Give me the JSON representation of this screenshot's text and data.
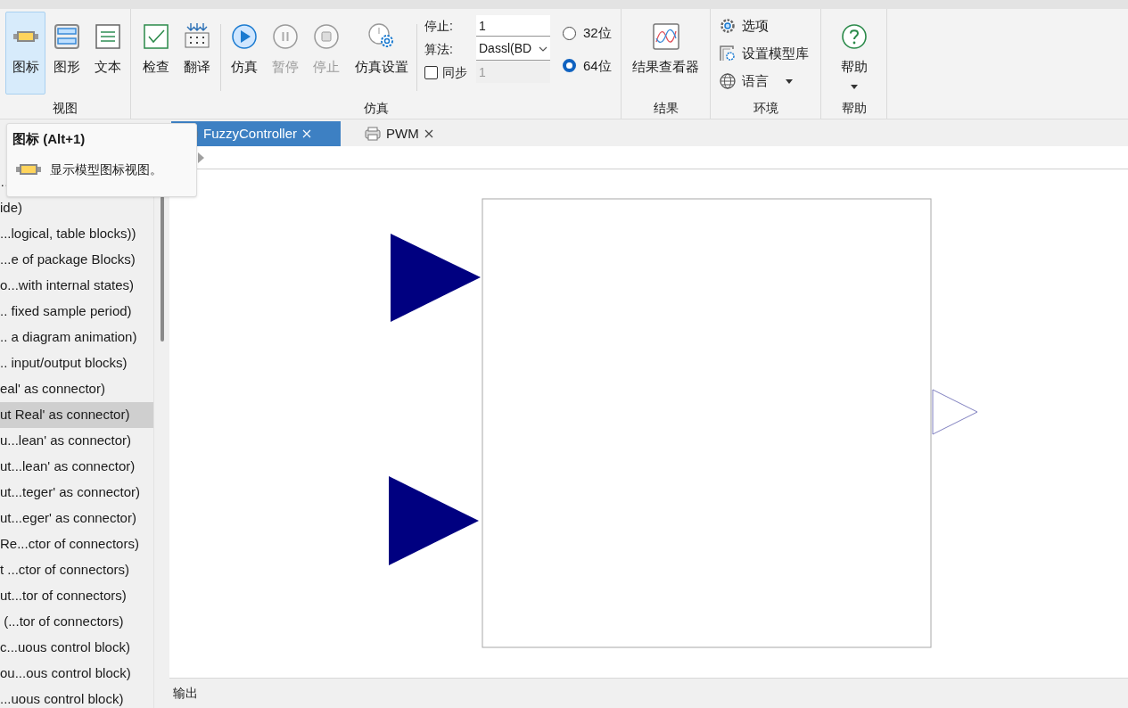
{
  "ribbon": {
    "view": {
      "label": "视图",
      "buttons": [
        {
          "label": "图标",
          "selected": true
        },
        {
          "label": "图形",
          "selected": false
        },
        {
          "label": "文本",
          "selected": false
        }
      ]
    },
    "simulation": {
      "label": "仿真",
      "buttons": [
        {
          "label": "检查",
          "disabled": false
        },
        {
          "label": "翻译",
          "disabled": false
        },
        {
          "label": "仿真",
          "disabled": false
        },
        {
          "label": "暂停",
          "disabled": true
        },
        {
          "label": "停止",
          "disabled": true
        },
        {
          "label": "仿真设置",
          "disabled": false
        }
      ],
      "stop_time": {
        "label": "停止:",
        "value": "1"
      },
      "solver": {
        "label": "算法:",
        "value": "Dassl(BD"
      },
      "sync": {
        "label": "同步",
        "checked": false,
        "value": "1"
      },
      "bits": [
        {
          "label": "32位",
          "selected": false
        },
        {
          "label": "64位",
          "selected": true
        }
      ]
    },
    "results": {
      "label": "结果",
      "buttons": [
        {
          "label": "结果查看器"
        }
      ]
    },
    "environment": {
      "label": "环境",
      "items": [
        {
          "label": "选项",
          "dropdown": false
        },
        {
          "label": "设置模型库",
          "dropdown": false
        },
        {
          "label": "语言",
          "dropdown": true
        }
      ]
    },
    "help": {
      "label": "帮助",
      "buttons": [
        {
          "label": "帮助",
          "dropdown": true
        }
      ]
    }
  },
  "tooltip": {
    "title": "图标 (Alt+1)",
    "text": "显示模型图标视图。"
  },
  "tabs": [
    {
      "label": "FuzzyController",
      "selected": true
    },
    {
      "label": "PWM",
      "selected": false
    }
  ],
  "library_list": [
    {
      "text": "…",
      "selected": false
    },
    {
      "text": "ide)",
      "selected": false
    },
    {
      "text": "...logical, table blocks))",
      "selected": false
    },
    {
      "text": "...e of package Blocks)",
      "selected": false
    },
    {
      "text": "o...with internal states)",
      "selected": false
    },
    {
      "text": ".. fixed sample period)",
      "selected": false
    },
    {
      "text": ".. a diagram animation)",
      "selected": false
    },
    {
      "text": ".. input/output blocks)",
      "selected": false
    },
    {
      "text": "eal' as connector)",
      "selected": false
    },
    {
      "text": "ut Real' as connector)",
      "selected": true
    },
    {
      "text": "u...lean' as connector)",
      "selected": false
    },
    {
      "text": "ut...lean' as connector)",
      "selected": false
    },
    {
      "text": "ut...teger' as connector)",
      "selected": false
    },
    {
      "text": "ut...eger' as connector)",
      "selected": false
    },
    {
      "text": "Re...ctor of connectors)",
      "selected": false
    },
    {
      "text": "t ...ctor of connectors)",
      "selected": false
    },
    {
      "text": "ut...tor of connectors)",
      "selected": false
    },
    {
      "text": " (...tor of connectors)",
      "selected": false
    },
    {
      "text": "c...uous control block)",
      "selected": false
    },
    {
      "text": "ou...ous control block)",
      "selected": false
    },
    {
      "text": "...uous control block)",
      "selected": false
    }
  ],
  "output_panel": {
    "label": "输出"
  }
}
